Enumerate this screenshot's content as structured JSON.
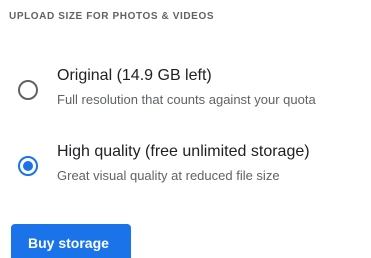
{
  "section": {
    "title": "UPLOAD SIZE FOR PHOTOS & VIDEOS"
  },
  "options": [
    {
      "title": "Original (14.9 GB left)",
      "description": "Full resolution that counts against your quota",
      "selected": false
    },
    {
      "title": "High quality (free unlimited storage)",
      "description": "Great visual quality at reduced file size",
      "selected": true
    }
  ],
  "actions": {
    "buy_storage_label": "Buy storage"
  },
  "colors": {
    "accent": "#1a73e8",
    "primary_text": "#202124",
    "secondary_text": "#5f6368"
  }
}
